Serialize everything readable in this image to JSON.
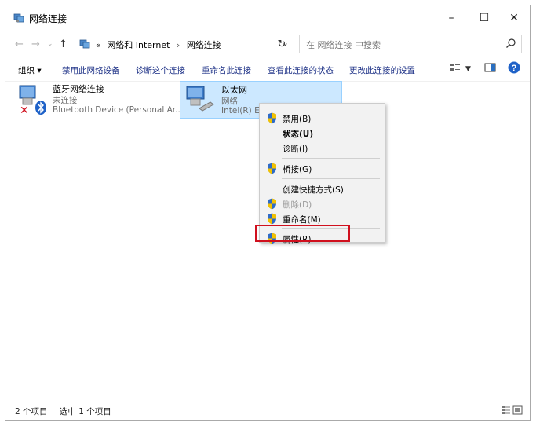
{
  "window": {
    "title": "网络连接"
  },
  "titlebar": {
    "minimize": "–",
    "maximize": "☐",
    "close": "✕"
  },
  "address": {
    "prefix": "«",
    "crumbs": [
      "网络和 Internet",
      "网络连接"
    ],
    "separator": "›",
    "dropdown": "⌄",
    "refresh": "↻",
    "search_placeholder": "在 网络连接 中搜索"
  },
  "toolbar": {
    "organize": "组织 ▾",
    "disable": "禁用此网络设备",
    "diagnose": "诊断这个连接",
    "rename": "重命名此连接",
    "view_status": "查看此连接的状态",
    "change_settings": "更改此连接的设置"
  },
  "items": [
    {
      "name": "蓝牙网络连接",
      "status": "未连接",
      "device": "Bluetooth Device (Personal Ar..."
    },
    {
      "name": "以太网",
      "status": "网络",
      "device": "Intel(R) Eth"
    }
  ],
  "context_menu": {
    "disable": "禁用(B)",
    "status": "状态(U)",
    "diagnose": "诊断(I)",
    "bridge": "桥接(G)",
    "shortcut": "创建快捷方式(S)",
    "delete": "删除(D)",
    "rename": "重命名(M)",
    "properties": "属性(R)"
  },
  "statusbar": {
    "count": "2 个项目",
    "selected": "选中 1 个项目"
  },
  "colors": {
    "accent": "#1e3287",
    "selection": "#cce8ff",
    "highlight_border": "#d0101e",
    "menu_bg": "#f2f2f2"
  }
}
